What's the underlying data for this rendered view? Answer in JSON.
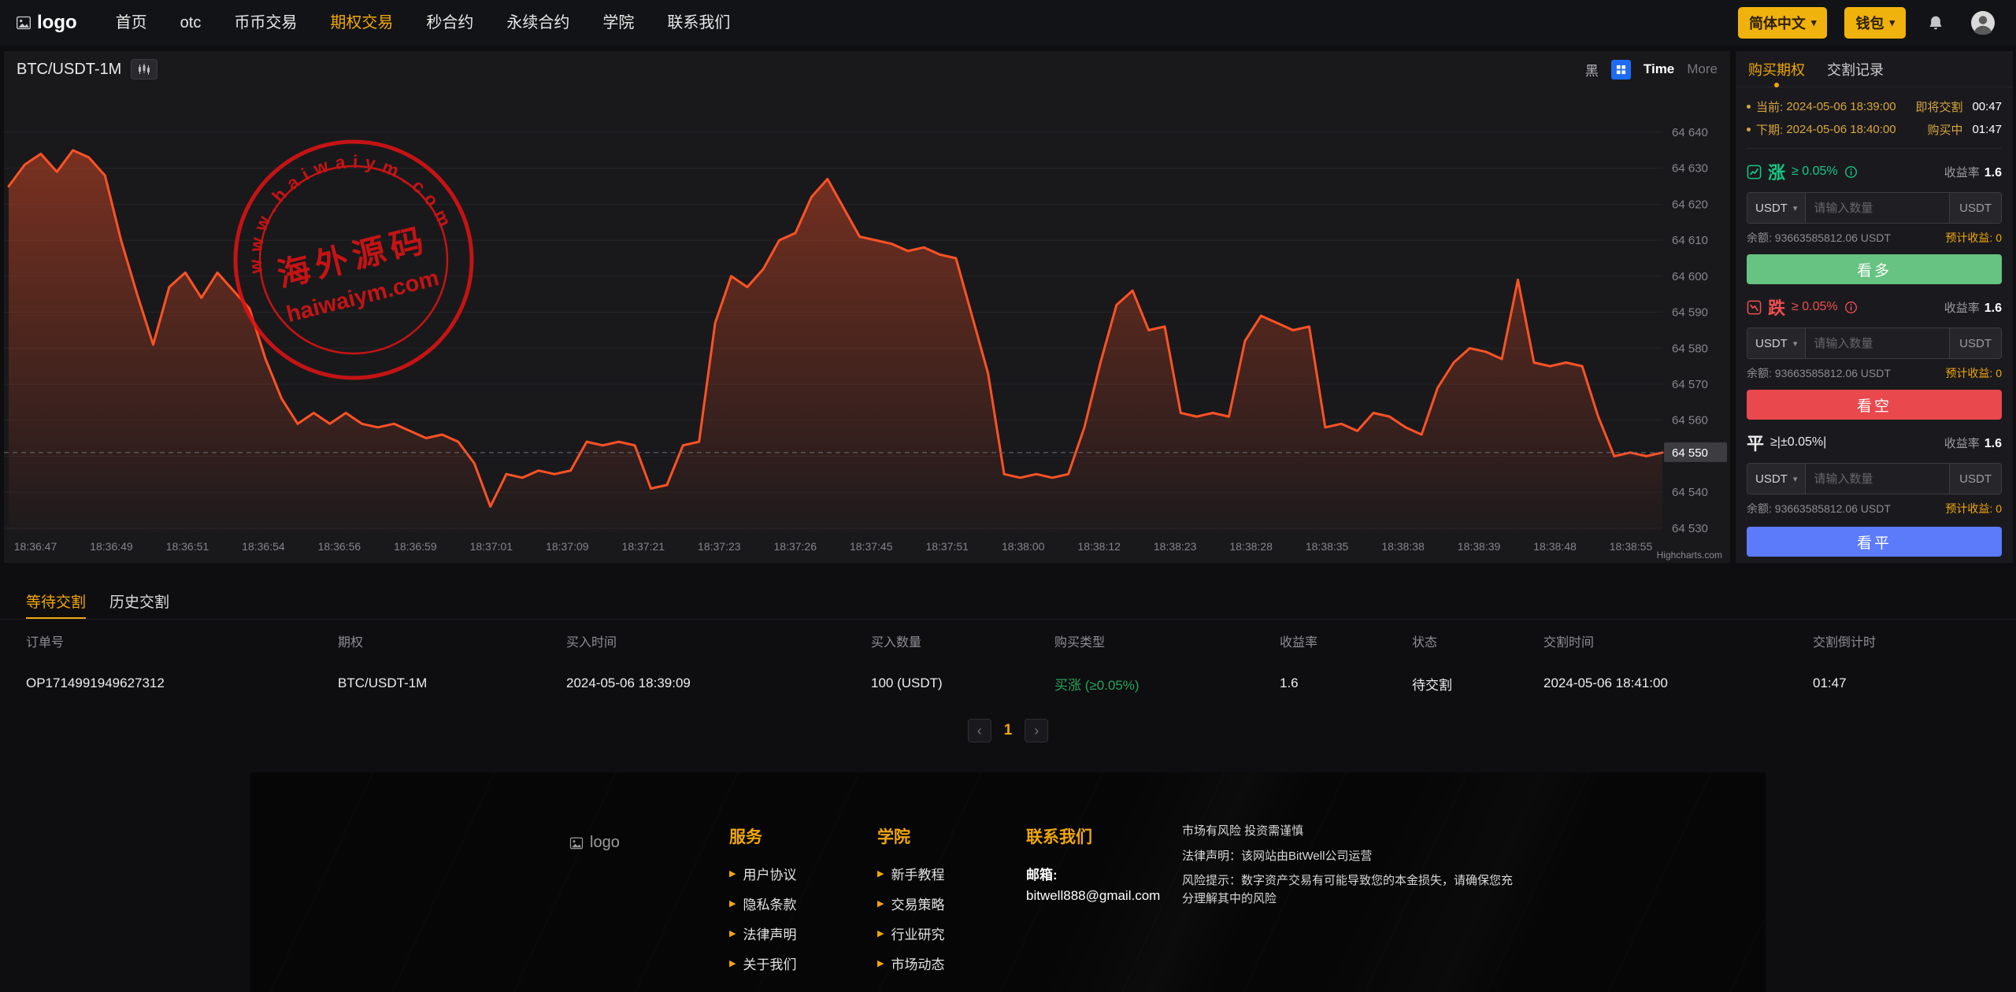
{
  "navbar": {
    "logo_text": "logo",
    "items": [
      {
        "label": "首页"
      },
      {
        "label": "otc"
      },
      {
        "label": "币币交易"
      },
      {
        "label": "期权交易"
      },
      {
        "label": "秒合约"
      },
      {
        "label": "永续合约"
      },
      {
        "label": "学院"
      },
      {
        "label": "联系我们"
      }
    ],
    "lang_button": "简体中文",
    "wallet_button": "钱包"
  },
  "chart": {
    "symbol": "BTC/USDT-1M",
    "theme_label": "黑",
    "interval_label": "Time",
    "more_label": "More",
    "credit": "Highcharts.com",
    "current_price": "64 550"
  },
  "chart_data": {
    "type": "area",
    "title": "BTC/USDT 1-minute price",
    "ylim": [
      64530,
      64645
    ],
    "y_top": 64640,
    "y_step": 10,
    "grid": true,
    "y_labels": [
      "64 640",
      "64 630",
      "64 620",
      "64 610",
      "64 600",
      "64 590",
      "64 580",
      "64 570",
      "64 560",
      "64 550",
      "64 540",
      "64 530"
    ],
    "x_labels": [
      "18:36:47",
      "18:36:49",
      "18:36:51",
      "18:36:54",
      "18:36:56",
      "18:36:59",
      "18:37:01",
      "18:37:09",
      "18:37:21",
      "18:37:23",
      "18:37:26",
      "18:37:45",
      "18:37:51",
      "18:38:00",
      "18:38:12",
      "18:38:23",
      "18:38:28",
      "18:38:35",
      "18:38:38",
      "18:38:39",
      "18:38:48",
      "18:38:55"
    ],
    "prices": [
      64625,
      64631,
      64634,
      64629,
      64635,
      64633,
      64628,
      64610,
      64595,
      64581,
      64597,
      64601,
      64594,
      64601,
      64596,
      64591,
      64577,
      64566,
      64559,
      64562,
      64559,
      64562,
      64559,
      64558,
      64559,
      64557,
      64555,
      64556,
      64554,
      64548,
      64536,
      64545,
      64544,
      64546,
      64545,
      64546,
      64554,
      64553,
      64554,
      64553,
      64541,
      64542,
      64553,
      64554,
      64587,
      64600,
      64597,
      64602,
      64610,
      64612,
      64622,
      64627,
      64619,
      64611,
      64610,
      64609,
      64607,
      64608,
      64606,
      64605,
      64589,
      64573,
      64545,
      64544,
      64545,
      64544,
      64545,
      64558,
      64576,
      64592,
      64596,
      64585,
      64586,
      64562,
      64561,
      64562,
      64561,
      64582,
      64589,
      64587,
      64585,
      64586,
      64558,
      64559,
      64557,
      64562,
      64561,
      64558,
      64556,
      64569,
      64576,
      64580,
      64579,
      64577,
      64599,
      64576,
      64575,
      64576,
      64575,
      64561,
      64550,
      64551,
      64550,
      64551
    ]
  },
  "watermark": {
    "arc_top": "w w w . h a i w a i y m . c o m",
    "center_cn": "海外源码",
    "center_en": "haiwaiym.com"
  },
  "trade_panel": {
    "tabs": [
      "购买期权",
      "交割记录"
    ],
    "current_label": "当前:",
    "current_time": "2024-05-06 18:39:00",
    "settle_label": "即将交割",
    "settle_countdown": "00:47",
    "next_label": "下期:",
    "next_time": "2024-05-06 18:40:00",
    "buying_label": "购买中",
    "buying_countdown": "01:47",
    "sections": [
      {
        "name": "涨",
        "cond": "≥ 0.05%",
        "rate_label": "收益率",
        "rate": "1.6",
        "currency": "USDT",
        "placeholder": "请输入数量",
        "suffix": "USDT",
        "balance_label": "余额:",
        "balance": "93663585812.06 USDT",
        "profit_label": "预计收益:",
        "profit": "0",
        "button": "看多"
      },
      {
        "name": "跌",
        "cond": "≥ 0.05%",
        "rate_label": "收益率",
        "rate": "1.6",
        "currency": "USDT",
        "placeholder": "请输入数量",
        "suffix": "USDT",
        "balance_label": "余额:",
        "balance": "93663585812.06 USDT",
        "profit_label": "预计收益:",
        "profit": "0",
        "button": "看空"
      },
      {
        "name": "平",
        "cond": "≥|±0.05%|",
        "rate_label": "收益率",
        "rate": "1.6",
        "currency": "USDT",
        "placeholder": "请输入数量",
        "suffix": "USDT",
        "balance_label": "余额:",
        "balance": "93663585812.06 USDT",
        "profit_label": "预计收益:",
        "profit": "0",
        "button": "看平"
      }
    ]
  },
  "orders": {
    "tabs": [
      "等待交割",
      "历史交割"
    ],
    "headers": [
      "订单号",
      "期权",
      "买入时间",
      "买入数量",
      "购买类型",
      "收益率",
      "状态",
      "交割时间",
      "交割倒计时"
    ],
    "rows": [
      [
        "OP1714991949627312",
        "BTC/USDT-1M",
        "2024-05-06 18:39:09",
        "100 (USDT)",
        "买涨 (≥0.05%)",
        "1.6",
        "待交割",
        "2024-05-06 18:41:00",
        "01:47"
      ]
    ],
    "pagination": {
      "prev": "‹",
      "page": "1",
      "next": "›"
    }
  },
  "footer": {
    "logo_text": "logo",
    "columns": [
      {
        "title": "服务",
        "links": [
          "用户协议",
          "隐私条款",
          "法律声明",
          "关于我们"
        ]
      },
      {
        "title": "学院",
        "links": [
          "新手教程",
          "交易策略",
          "行业研究",
          "市场动态"
        ]
      },
      {
        "title": "联系我们",
        "lines": [
          "邮箱:",
          "bitwell888@gmail.com"
        ]
      }
    ],
    "disclaimer": [
      "市场有风险 投资需谨慎",
      "法律声明：该网站由BitWell公司运营",
      "风险提示：数字资产交易有可能导致您的本金损失，请确保您充分理解其中的风险"
    ]
  },
  "colors": {
    "accent": "#f0a70a",
    "chart_line": "#ff5226",
    "buy_green": "#67c381",
    "sell_red": "#e9484d",
    "flat_blue": "#5b7bfa",
    "up_text": "#16c784",
    "down_text": "#ef4e4e"
  }
}
